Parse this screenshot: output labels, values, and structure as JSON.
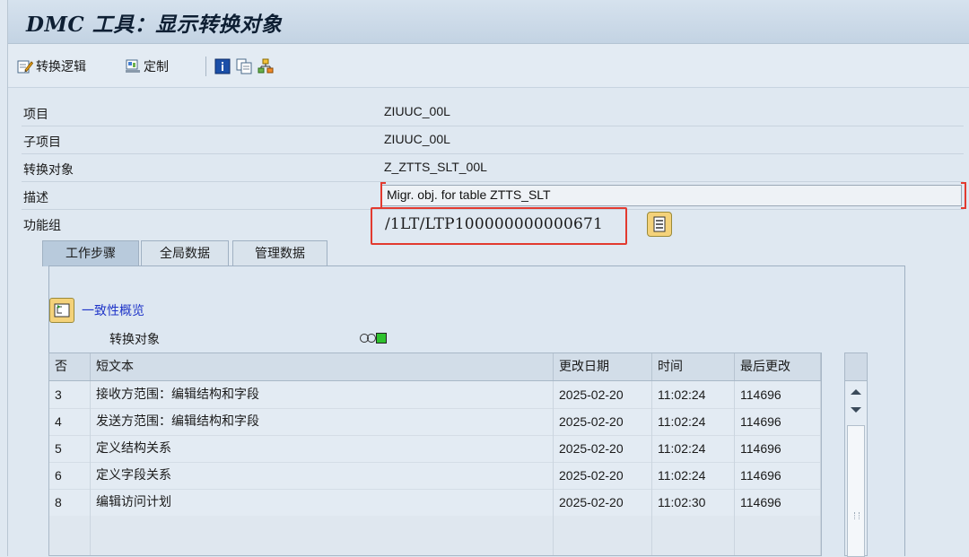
{
  "window": {
    "title": "DMC 工具：显示转换对象"
  },
  "toolbar": {
    "items": [
      {
        "label": "转换逻辑",
        "icon": "edit-logic-icon"
      },
      {
        "label": "定制",
        "icon": "customize-icon"
      },
      {
        "label": "",
        "icon": "info-icon"
      },
      {
        "label": "",
        "icon": "copy-document-icon"
      },
      {
        "label": "",
        "icon": "hierarchy-icon"
      }
    ]
  },
  "header": {
    "project_label": "项目",
    "project_value": "ZIUUC_00L",
    "subproject_label": "子项目",
    "subproject_value": "ZIUUC_00L",
    "conversion_object_label": "转换对象",
    "conversion_object_value": "Z_ZTTS_SLT_00L",
    "description_label": "描述",
    "description_value": "Migr. obj. for table ZTTS_SLT",
    "function_group_label": "功能组",
    "function_group_value": "/1LT/LTP100000000000671"
  },
  "tabs": [
    {
      "label": "工作步骤",
      "active": true
    },
    {
      "label": "全局数据",
      "active": false
    },
    {
      "label": "管理数据",
      "active": false
    }
  ],
  "panel": {
    "consistency_link": "一致性概览",
    "conversion_object_label": "转换对象",
    "status_light": "green"
  },
  "table": {
    "columns": [
      "否",
      "短文本",
      "更改日期",
      "时间",
      "最后更改"
    ],
    "rows": [
      {
        "no": "3",
        "text": "接收方范围：编辑结构和字段",
        "date": "2025-02-20",
        "time": "11:02:24",
        "user": "114696"
      },
      {
        "no": "4",
        "text": "发送方范围：编辑结构和字段",
        "date": "2025-02-20",
        "time": "11:02:24",
        "user": "114696"
      },
      {
        "no": "5",
        "text": "定义结构关系",
        "date": "2025-02-20",
        "time": "11:02:24",
        "user": "114696"
      },
      {
        "no": "6",
        "text": "定义字段关系",
        "date": "2025-02-20",
        "time": "11:02:24",
        "user": "114696"
      },
      {
        "no": "8",
        "text": "编辑访问计划",
        "date": "2025-02-20",
        "time": "11:02:30",
        "user": "114696"
      }
    ]
  },
  "colors": {
    "highlight": "#e23a2f",
    "link": "#1f35c8",
    "status_green": "#2ec22e"
  }
}
